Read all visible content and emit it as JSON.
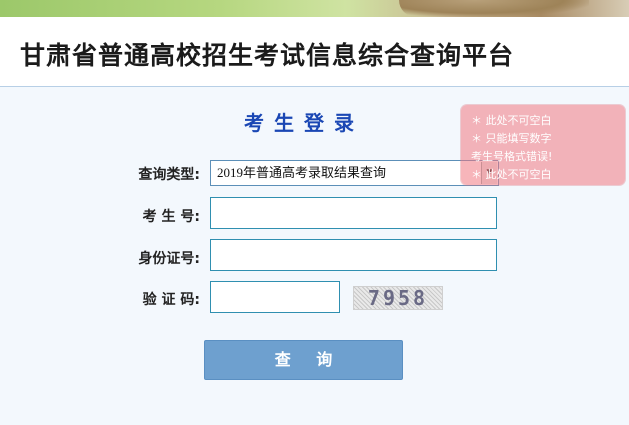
{
  "header": {
    "title": "甘肃省普通高校招生考试信息综合查询平台"
  },
  "login": {
    "title": "考生登录",
    "query_type_label": "查询类型:",
    "query_type_selected": "2019年普通高考录取结果查询",
    "candidate_no_label": "考 生 号:",
    "candidate_no_value": "",
    "id_card_label": "身份证号:",
    "id_card_value": "",
    "captcha_label": "验 证 码:",
    "captcha_value": "",
    "captcha_image_text": "7958",
    "submit_label": "查 询"
  },
  "validation_tooltip": {
    "lines": [
      "＊ 此处不可空白",
      "＊ 只能填写数字",
      "考生号格式错误!",
      "＊ 此处不可空白"
    ]
  },
  "colors": {
    "title_blue": "#1a47b4",
    "button": "#6ea0cf",
    "input_border": "#2f8fb0",
    "tooltip": "#f0a0a8",
    "panel_bg": "#f3f8fd"
  }
}
